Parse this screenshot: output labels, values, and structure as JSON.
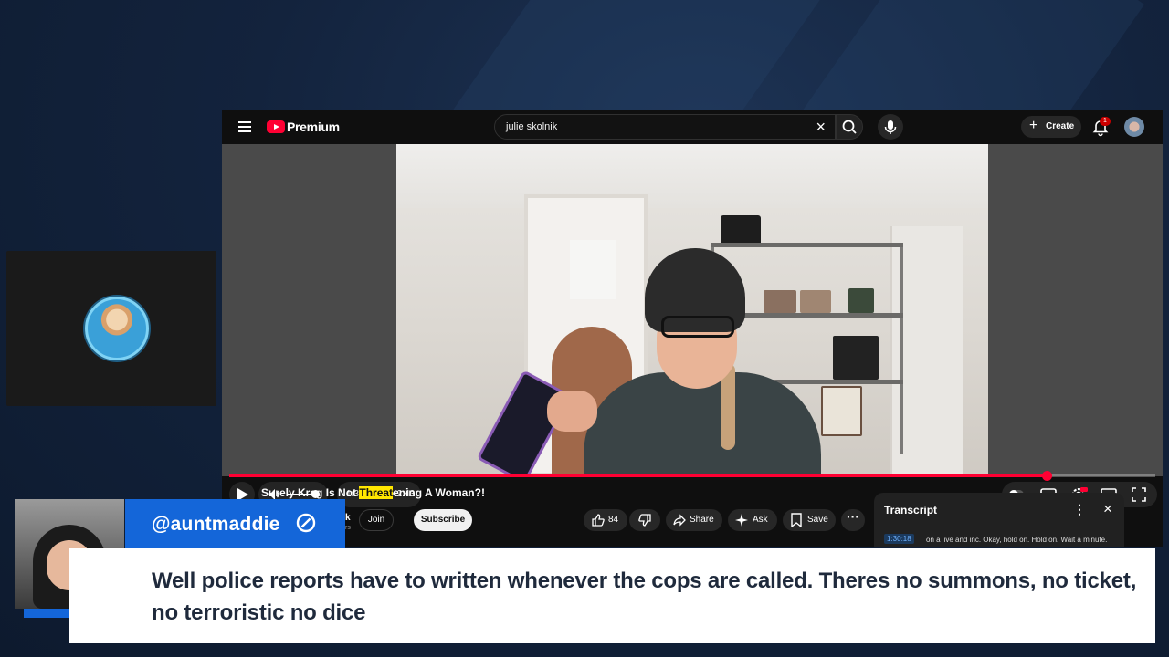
{
  "colors": {
    "youtube_red": "#ff0033",
    "overlay_blue": "#1466d9",
    "highlight_yellow": "#ffe600",
    "comment_text": "#1f2a3c"
  },
  "topbar": {
    "brand": "Premium",
    "search_value": "julie skolnik",
    "create_label": "Create",
    "notification_count": "1",
    "icons": [
      "menu-icon",
      "youtube-logo",
      "close-icon",
      "search-icon",
      "mic-icon",
      "bell-icon",
      "avatar"
    ]
  },
  "player": {
    "time_display": "1:30:38 / 1:42:43",
    "progress_fraction": 0.883,
    "volume_fraction": 0.8,
    "icons": [
      "play-icon",
      "volume-icon",
      "autoplay-toggle-icon",
      "captions-icon",
      "settings-icon",
      "theater-icon",
      "fullscreen-icon"
    ]
  },
  "video": {
    "title_before": "Surely Kreg Is Not ",
    "title_highlight": "Threat",
    "title_after": "ening A Woman?!",
    "channel_fragment": "k",
    "subscribers_fragment": "rs",
    "join_label": "Join",
    "subscribe_label": "Subscribe",
    "like_count": "84",
    "share_label": "Share",
    "ask_label": "Ask",
    "save_label": "Save"
  },
  "transcript": {
    "title": "Transcript",
    "timestamp": "1:30:18",
    "line": "on a live and inc. Okay, hold on. Hold on. Wait a minute."
  },
  "overlay": {
    "username": "@auntmaddie",
    "comment": "Well police reports have to written whenever the cops are called. Theres no summons, no ticket, no terroristic no dice"
  }
}
